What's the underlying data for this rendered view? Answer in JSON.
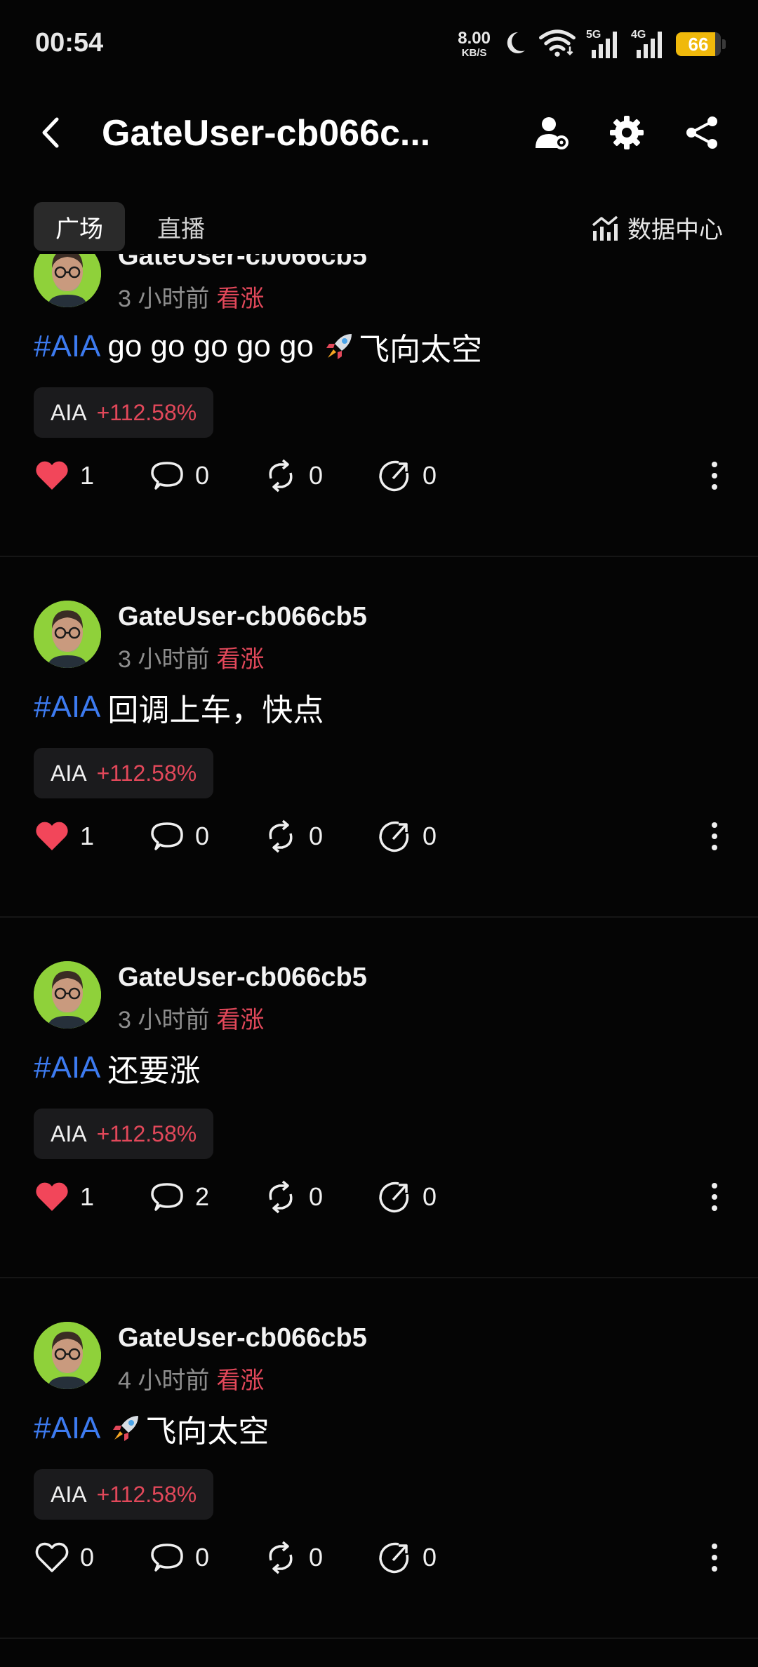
{
  "status_bar": {
    "time": "00:54",
    "net_speed_value": "8.00",
    "net_speed_unit": "KB/S",
    "signal_5g_label": "5G",
    "signal_4g_label": "4G",
    "battery_level": "66",
    "battery_color": "#f0b90b"
  },
  "header": {
    "title": "GateUser-cb066c...",
    "icons": [
      "back-icon",
      "user-settings-icon",
      "gear-icon",
      "share-icon"
    ]
  },
  "tabs": {
    "items": [
      {
        "label": "广场",
        "active": true
      },
      {
        "label": "直播",
        "active": false
      }
    ],
    "data_center_label": "数据中心"
  },
  "colors": {
    "hashtag": "#3d7bf0",
    "bullish": "#e2485a",
    "like_active": "#f2465a",
    "avatar_bg": "#8fd13a"
  },
  "posts": [
    {
      "username": "GateUser-cb066cb5",
      "time": "3 小时前",
      "sentiment": "看涨",
      "hashtag": "#AIA",
      "text_before_rocket": "go go go go go",
      "has_rocket": true,
      "text_after_rocket": "飞向太空",
      "chip_symbol": "AIA",
      "chip_change": "+112.58%",
      "likes": "1",
      "liked": true,
      "comments": "0",
      "reposts": "0",
      "shares": "0"
    },
    {
      "username": "GateUser-cb066cb5",
      "time": "3 小时前",
      "sentiment": "看涨",
      "hashtag": "#AIA",
      "text_before_rocket": "回调上车，快点",
      "has_rocket": false,
      "text_after_rocket": "",
      "chip_symbol": "AIA",
      "chip_change": "+112.58%",
      "likes": "1",
      "liked": true,
      "comments": "0",
      "reposts": "0",
      "shares": "0"
    },
    {
      "username": "GateUser-cb066cb5",
      "time": "3 小时前",
      "sentiment": "看涨",
      "hashtag": "#AIA",
      "text_before_rocket": "还要涨",
      "has_rocket": false,
      "text_after_rocket": "",
      "chip_symbol": "AIA",
      "chip_change": "+112.58%",
      "likes": "1",
      "liked": true,
      "comments": "2",
      "reposts": "0",
      "shares": "0"
    },
    {
      "username": "GateUser-cb066cb5",
      "time": "4 小时前",
      "sentiment": "看涨",
      "hashtag": "#AIA",
      "text_before_rocket": "",
      "has_rocket": true,
      "text_after_rocket": "飞向太空",
      "chip_symbol": "AIA",
      "chip_change": "+112.58%",
      "likes": "0",
      "liked": false,
      "comments": "0",
      "reposts": "0",
      "shares": "0"
    }
  ]
}
